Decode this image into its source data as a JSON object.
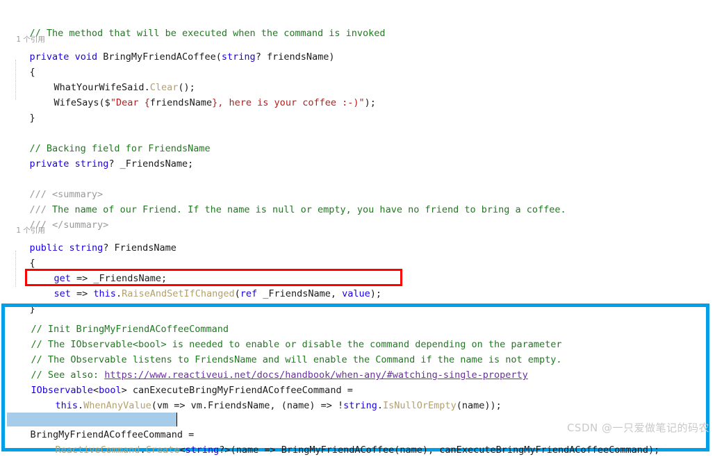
{
  "editor": {
    "language": "csharp",
    "background": "#ffffff",
    "colors": {
      "comment": "#1f7a1f",
      "doc_slash": "#9a9a9a",
      "keyword": "#1a00e6",
      "type": "#1a00e6",
      "method": "#b3a06a",
      "string": "#b81c1c",
      "identifier": "#1a1a1a",
      "link": "#6a2fa0",
      "selection": "#a6ccea",
      "red_annotation": "#ff0000",
      "blue_annotation": "#00a0e9",
      "codelens": "#9a9a9a",
      "watermark": "#c9c9c9"
    }
  },
  "codelens": {
    "method_refs": "1 个引用",
    "property_refs": "1 个引用"
  },
  "code": {
    "l1_comment": "// The method that will be executed when the command is invoked",
    "l2": {
      "kw_private": "private",
      "kw_void": "void",
      "name": "BringMyFriendACoffee",
      "open_paren": "(",
      "param_type": "string",
      "param_nullable": "? ",
      "param_name": "friendsName",
      "close_paren": ")"
    },
    "l3_brace_open": "{",
    "l4": {
      "obj": "WhatYourWifeSaid",
      "dot": ".",
      "method": "Clear",
      "tail": "();"
    },
    "l5": {
      "method": "WifeSays",
      "open": "($",
      "quote_open": "\"",
      "str_a": "Dear ",
      "brace_open": "{",
      "interp": "friendsName",
      "brace_close": "}",
      "str_b": ", here is your coffee :-)",
      "quote_close": "\"",
      "tail": ");"
    },
    "l6_brace_close": "}",
    "l7_comment": "// Backing field for FriendsName",
    "l8": {
      "kw_private": "private",
      "type": "string",
      "nullable": "? ",
      "name": "_FriendsName",
      "semi": ";"
    },
    "l9_doc_open": {
      "slashes": "/// ",
      "tag": "<summary>"
    },
    "l10_doc_text": {
      "slashes": "/// ",
      "text": "The name of our Friend. If the name is null or empty, you have no friend to bring a coffee."
    },
    "l11_doc_close": {
      "slashes": "/// ",
      "tag": "</summary>"
    },
    "l12": {
      "kw_public": "public",
      "type": "string",
      "nullable": "? ",
      "name": "FriendsName"
    },
    "l13_brace_open": "{",
    "l14_get": {
      "kw": "get",
      "arrow": " => ",
      "field": "_FriendsName",
      "semi": ";"
    },
    "l15_set": {
      "kw": "set",
      "arrow": " => ",
      "this": "this",
      "dot": ".",
      "method": "RaiseAndSetIfChanged",
      "open": "(",
      "kw_ref": "ref",
      "field": " _FriendsName, ",
      "kw_value": "value",
      "tail": ");"
    },
    "l16_brace_close": "}",
    "l17_comment": "// Init BringMyFriendACoffeeCommand",
    "l18_comment": "// The IObservable<bool> is needed to enable or disable the command depending on the parameter",
    "l19_comment": "// The Observable listens to FriendsName and will enable the Command if the name is not empty.",
    "l20": {
      "prefix": "// See also: ",
      "url": "https://www.reactiveui.net/docs/handbook/when-any/#watching-single-property"
    },
    "l21": {
      "type": "IObservable",
      "generic_open": "<",
      "generic_type": "bool",
      "generic_close": "> ",
      "name": "canExecuteBringMyFriendACoffeeCommand",
      "eq": " ="
    },
    "l22": {
      "this": "this",
      "dot": ".",
      "method": "WhenAnyValue",
      "open": "(",
      "lambda_a": "vm => vm",
      "dot2": ".",
      "prop": "FriendsName, (name) => !",
      "type": "string",
      "dot3": ".",
      "method2": "IsNullOrEmpty",
      "tail": "(name));"
    },
    "l23": {
      "selected_identifier": "BringMyFriendACoffeeCommand",
      "eq": " ="
    },
    "l24": {
      "cls": "ReactiveCommand",
      "dot": ".",
      "method": "Create",
      "generic_open": "<",
      "generic_type": "string",
      "generic_nullable": "?",
      "generic_close": ">",
      "open": "(name => ",
      "call": "BringMyFriendACoffee",
      "args": "(name), canExecuteBringMyFriendACoffeeCommand);"
    }
  },
  "annotations": {
    "red_box_target": "set => this.RaiseAndSetIfChanged(ref _FriendsName, value);",
    "blue_box_target": "Init BringMyFriendACoffeeCommand block"
  },
  "watermark": {
    "text": "CSDN @一只爱做笔记的码农"
  }
}
